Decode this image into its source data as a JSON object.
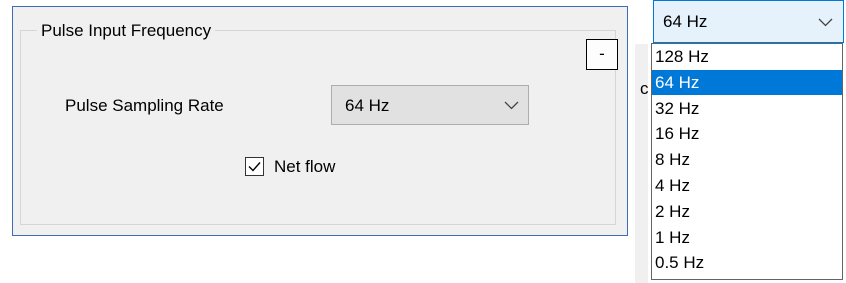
{
  "group": {
    "title": "Pulse Input Frequency",
    "collapse_label": "-"
  },
  "sampling": {
    "label": "Pulse Sampling Rate",
    "value": "64 Hz"
  },
  "net_flow": {
    "label": "Net flow",
    "checked": true
  },
  "dropdown": {
    "value": "64 Hz",
    "options": [
      "128 Hz",
      "64 Hz",
      "32 Hz",
      "16 Hz",
      "8 Hz",
      "4 Hz",
      "2 Hz",
      "1 Hz",
      "0.5 Hz"
    ],
    "selected_index": 1
  },
  "colors": {
    "accent": "#0078d7",
    "panel_border": "#3c6db4",
    "panel_bg": "#f0f0f0"
  },
  "icons": {
    "combo_arrow": "chevron-down-icon",
    "check": "checkmark-icon"
  }
}
